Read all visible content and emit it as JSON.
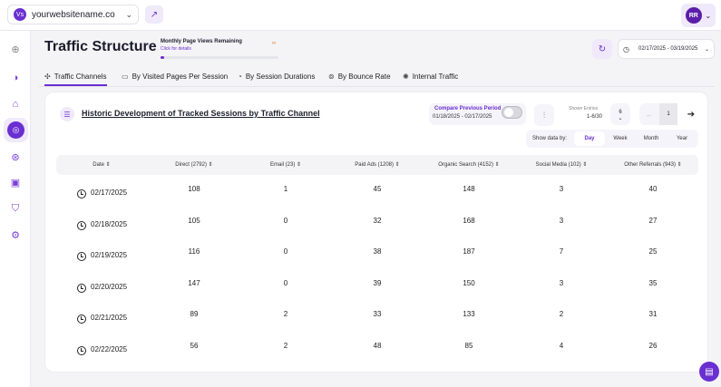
{
  "topbar": {
    "site_logo": "Vs",
    "site_name": "yourwebsitename.co",
    "user_initials": "RR"
  },
  "header": {
    "title": "Traffic Structure",
    "pageviews_title": "Monthly Page Views Remaining",
    "pageviews_link": "Click for details",
    "pageviews_fraction_used": 0.03,
    "date_range": "02/17/2025 - 03/19/2025"
  },
  "tabs": [
    {
      "label": "Traffic Channels",
      "icon": "channels-icon"
    },
    {
      "label": "By Visited Pages Per Session",
      "icon": "pages-icon"
    },
    {
      "label": "By Session Durations",
      "icon": "duration-icon"
    },
    {
      "label": "By Bounce Rate",
      "icon": "bounce-icon"
    },
    {
      "label": "Internal Traffic",
      "icon": "internal-icon"
    }
  ],
  "card": {
    "title": "Historic Development of Tracked Sessions by Traffic Channel",
    "compare_label": "Compare Previous Period",
    "compare_dates": "01/18/2025 - 02/17/2025",
    "entries_label": "Shown Entries",
    "entries_value": "1-6/30",
    "entries_select": "6",
    "page": "1",
    "show_by_label": "Show data by:",
    "show_by_options": [
      "Day",
      "Week",
      "Month",
      "Year"
    ],
    "show_by_selected": "Day"
  },
  "table": {
    "headers": [
      "Date",
      "Direct (2792)",
      "Email (23)",
      "Paid Ads (1208)",
      "Organic Search (4152)",
      "Social Media (102)",
      "Other Referrals (943)"
    ],
    "rows": [
      {
        "date": "02/17/2025",
        "direct": "108",
        "email": "1",
        "paid": "45",
        "organic": "148",
        "social": "3",
        "other": "40"
      },
      {
        "date": "02/18/2025",
        "direct": "105",
        "email": "0",
        "paid": "32",
        "organic": "168",
        "social": "3",
        "other": "27"
      },
      {
        "date": "02/19/2025",
        "direct": "116",
        "email": "0",
        "paid": "38",
        "organic": "187",
        "social": "7",
        "other": "25"
      },
      {
        "date": "02/20/2025",
        "direct": "147",
        "email": "0",
        "paid": "39",
        "organic": "150",
        "social": "3",
        "other": "35"
      },
      {
        "date": "02/21/2025",
        "direct": "89",
        "email": "2",
        "paid": "33",
        "organic": "133",
        "social": "2",
        "other": "31"
      },
      {
        "date": "02/22/2025",
        "direct": "56",
        "email": "2",
        "paid": "48",
        "organic": "85",
        "social": "4",
        "other": "26"
      }
    ]
  },
  "colors": {
    "accent": "#6a2fd1",
    "accent_light": "#efe9fb"
  }
}
